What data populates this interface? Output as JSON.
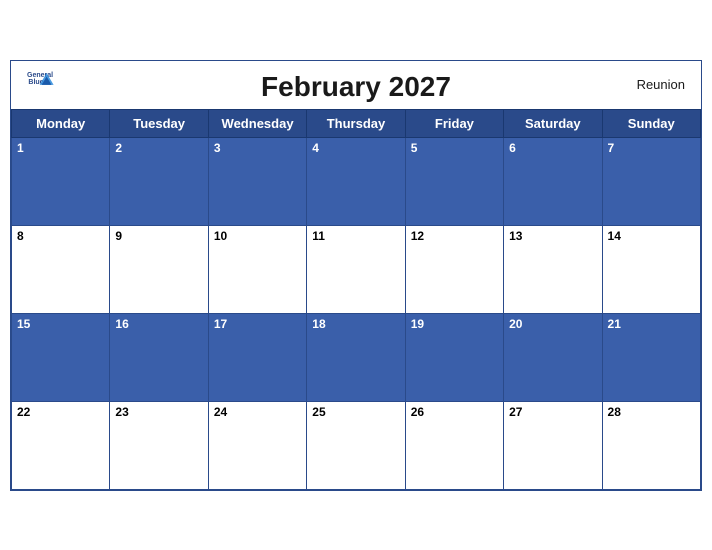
{
  "header": {
    "title": "February 2027",
    "region": "Reunion",
    "logo_general": "General",
    "logo_blue": "Blue"
  },
  "weekdays": [
    "Monday",
    "Tuesday",
    "Wednesday",
    "Thursday",
    "Friday",
    "Saturday",
    "Sunday"
  ],
  "weeks": [
    [
      1,
      2,
      3,
      4,
      5,
      6,
      7
    ],
    [
      8,
      9,
      10,
      11,
      12,
      13,
      14
    ],
    [
      15,
      16,
      17,
      18,
      19,
      20,
      21
    ],
    [
      22,
      23,
      24,
      25,
      26,
      27,
      28
    ]
  ],
  "row_types": [
    "blue",
    "white",
    "blue",
    "white"
  ]
}
